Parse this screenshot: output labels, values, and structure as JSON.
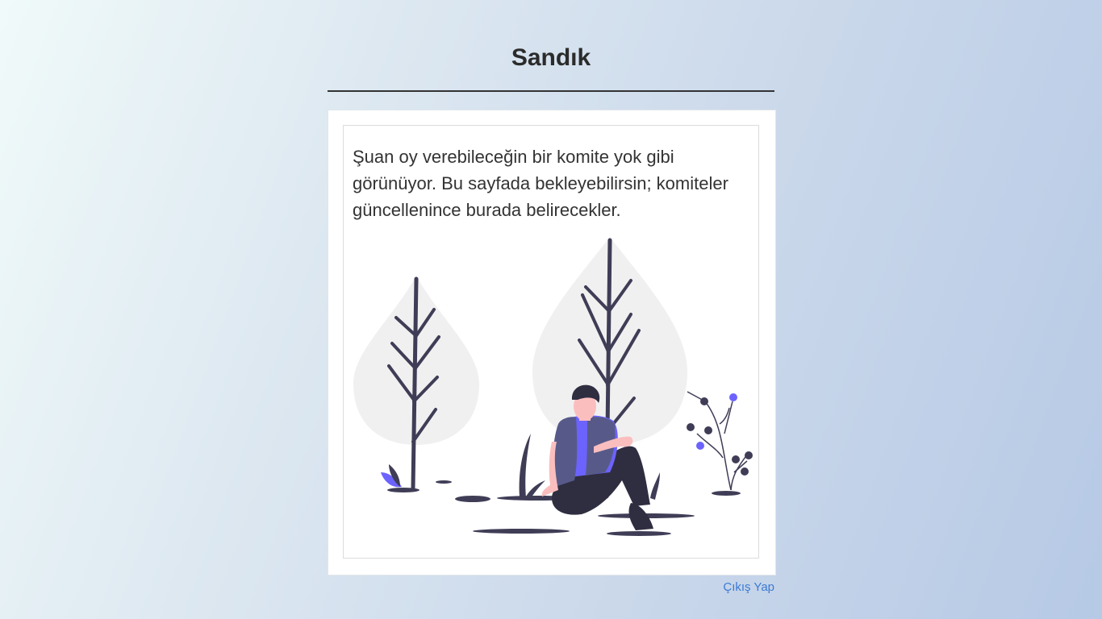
{
  "header": {
    "title": "Sandık"
  },
  "card": {
    "message": "Şuan oy verebileceğin bir komite yok gibi görünüyor. Bu sayfada bekleyebilirsin; komiteler güncellenince burada belirecekler.",
    "illustration": "person-sitting-under-trees-illustration"
  },
  "footer": {
    "logout_label": "Çıkış Yap"
  },
  "colors": {
    "accent": "#6c63ff",
    "dark": "#3f3d56",
    "link": "#3b7bd3"
  }
}
